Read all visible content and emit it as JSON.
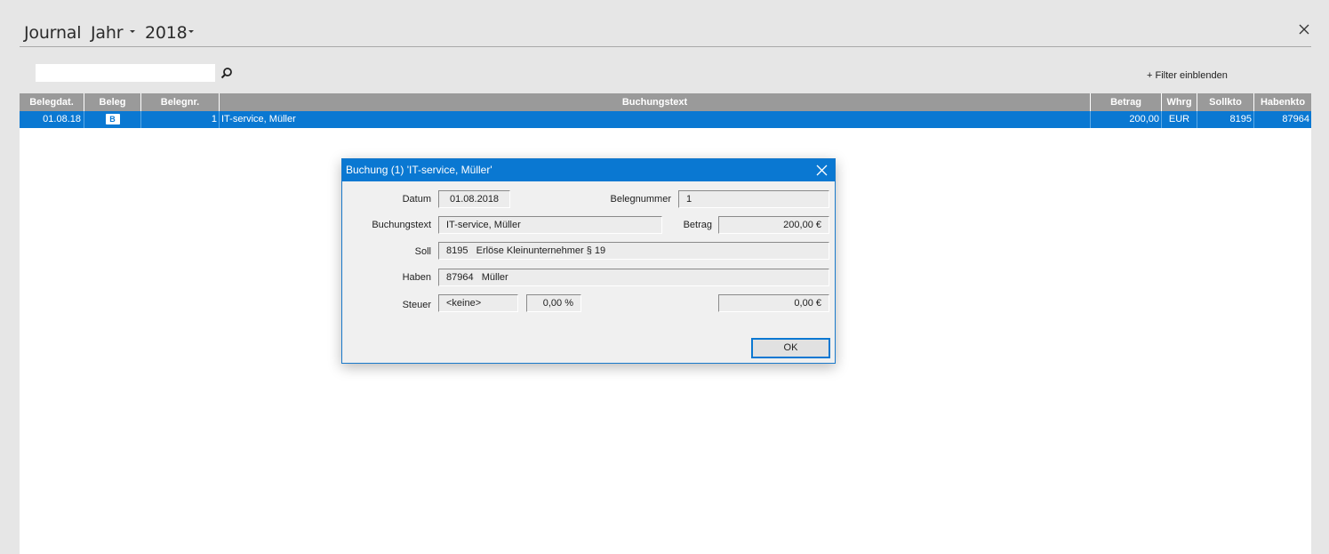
{
  "header": {
    "title": "Journal",
    "period_type": "Jahr",
    "year": "2018"
  },
  "search": {
    "value": "",
    "placeholder": ""
  },
  "filter_link": "+ Filter einblenden",
  "table": {
    "columns": [
      "Belegdat.",
      "Beleg",
      "Belegnr.",
      "Buchungstext",
      "Betrag",
      "Whrg",
      "Sollkto",
      "Habenkto"
    ],
    "rows": [
      {
        "belegdat": "01.08.18",
        "beleg_badge": "B",
        "belegnr": "1",
        "buchungstext": "IT-service, Müller",
        "betrag": "200,00",
        "whrg": "EUR",
        "sollkto": "8195",
        "habenkto": "87964"
      }
    ]
  },
  "dialog": {
    "title": "Buchung (1) 'IT-service, Müller'",
    "labels": {
      "datum": "Datum",
      "belegnummer": "Belegnummer",
      "buchungstext": "Buchungstext",
      "betrag": "Betrag",
      "soll": "Soll",
      "haben": "Haben",
      "steuer": "Steuer"
    },
    "values": {
      "datum": "01.08.2018",
      "belegnummer": "1",
      "buchungstext": "IT-service, Müller",
      "betrag": "200,00 €",
      "soll": "8195   Erlöse Kleinunternehmer § 19",
      "haben": "87964   Müller",
      "steuer_code": "<keine>",
      "steuer_rate": "0,00 %",
      "steuer_amount": "0,00 €"
    },
    "ok_label": "OK"
  },
  "colors": {
    "accent": "#0a78d2",
    "header_bg": "#9a9a9a",
    "page_bg": "#e6e6e6"
  }
}
